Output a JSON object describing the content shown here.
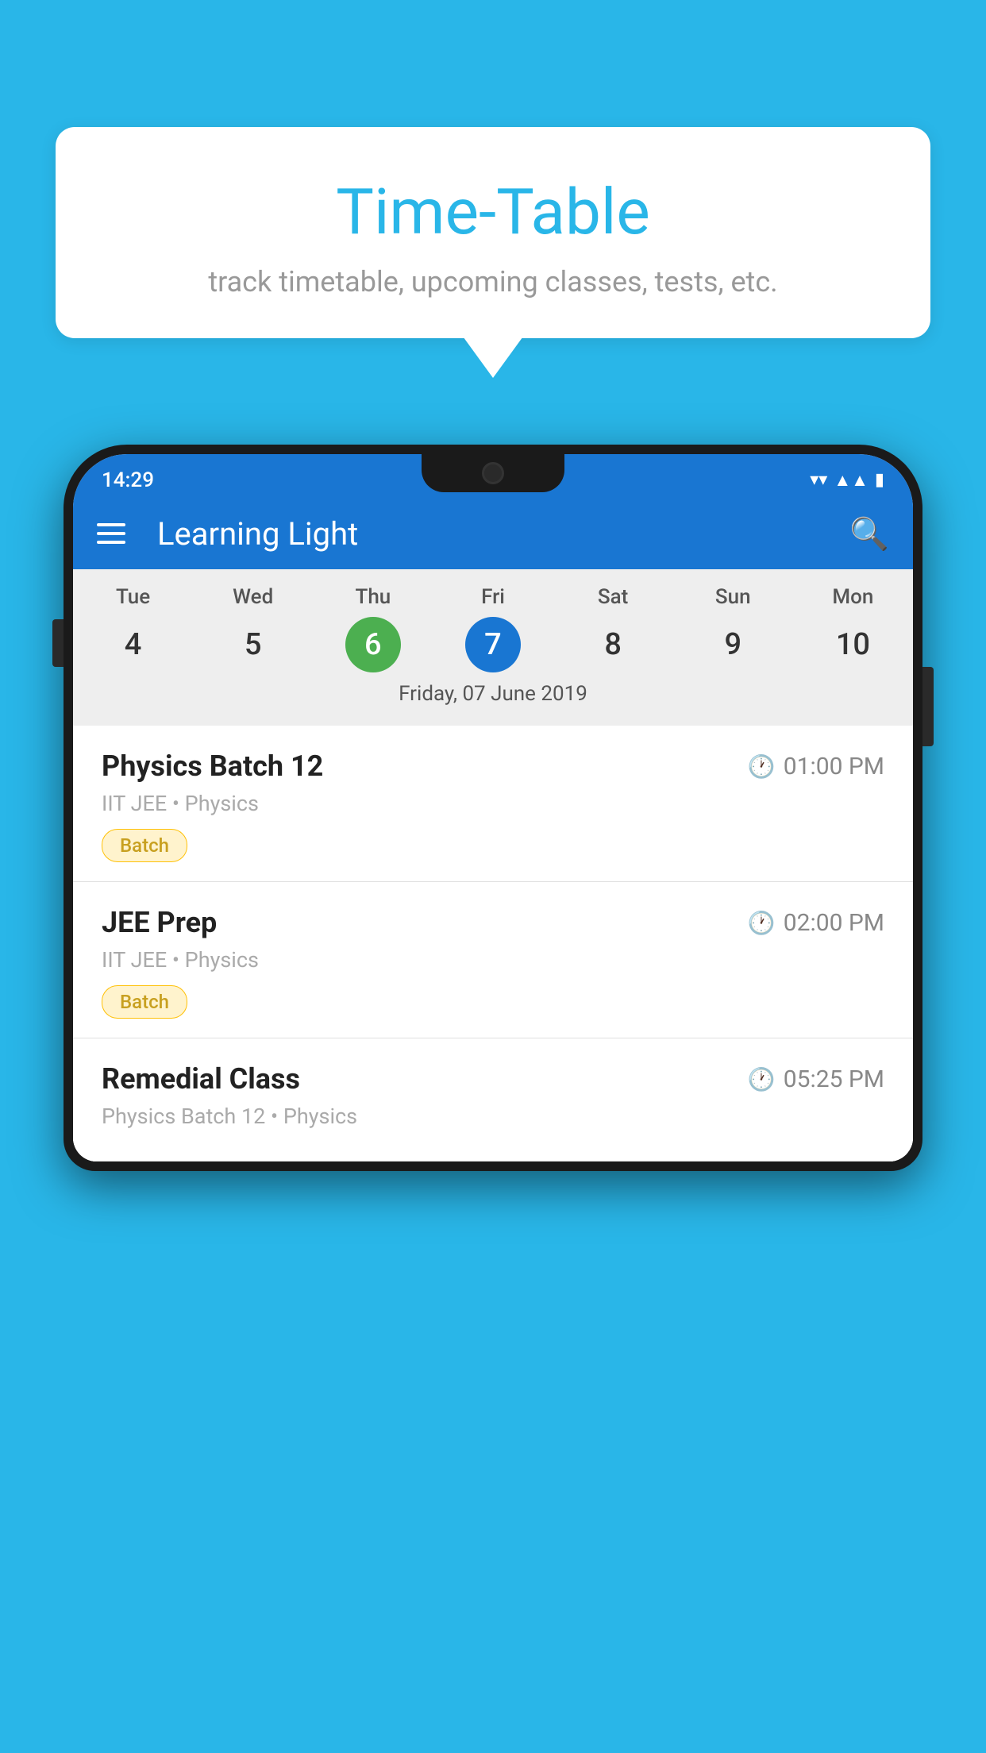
{
  "background_color": "#29b6e8",
  "bubble": {
    "title": "Time-Table",
    "subtitle": "track timetable, upcoming classes, tests, etc."
  },
  "app": {
    "title": "Learning Light",
    "status_time": "14:29"
  },
  "calendar": {
    "days": [
      {
        "name": "Tue",
        "number": "4",
        "state": "normal"
      },
      {
        "name": "Wed",
        "number": "5",
        "state": "normal"
      },
      {
        "name": "Thu",
        "number": "6",
        "state": "today"
      },
      {
        "name": "Fri",
        "number": "7",
        "state": "selected"
      },
      {
        "name": "Sat",
        "number": "8",
        "state": "normal"
      },
      {
        "name": "Sun",
        "number": "9",
        "state": "normal"
      },
      {
        "name": "Mon",
        "number": "10",
        "state": "normal"
      }
    ],
    "selected_date_label": "Friday, 07 June 2019"
  },
  "schedule": {
    "items": [
      {
        "title": "Physics Batch 12",
        "time": "01:00 PM",
        "subtitle": "IIT JEE • Physics",
        "tag": "Batch"
      },
      {
        "title": "JEE Prep",
        "time": "02:00 PM",
        "subtitle": "IIT JEE • Physics",
        "tag": "Batch"
      },
      {
        "title": "Remedial Class",
        "time": "05:25 PM",
        "subtitle": "Physics Batch 12 • Physics",
        "tag": ""
      }
    ]
  }
}
